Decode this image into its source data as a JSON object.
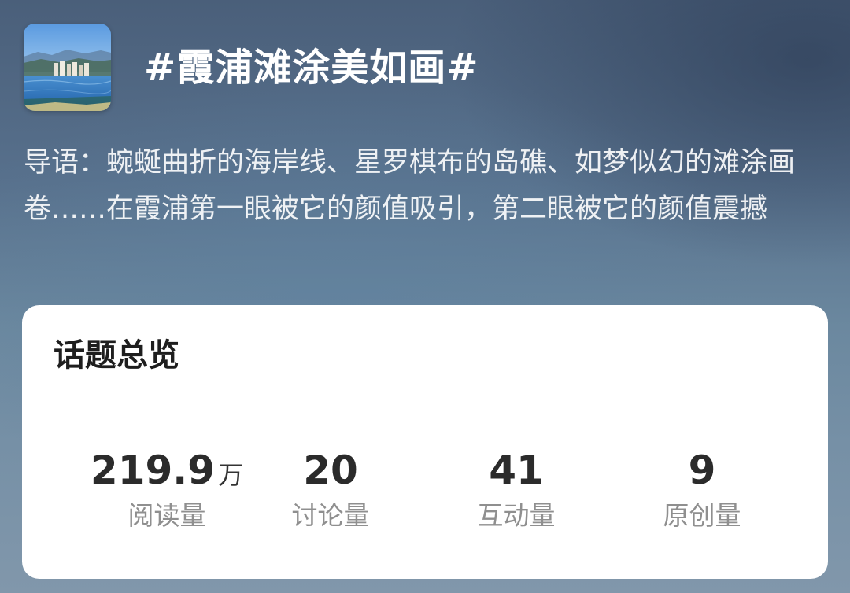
{
  "topic": {
    "title": "#霞浦滩涂美如画#",
    "intro": "导语：蜿蜒曲折的海岸线、星罗棋布的岛礁、如梦似幻的滩涂画卷……在霞浦第一眼被它的颜值吸引，第二眼被它的颜值震撼"
  },
  "overview": {
    "title": "话题总览",
    "stats": [
      {
        "value": "219.9",
        "unit": "万",
        "label": "阅读量"
      },
      {
        "value": "20",
        "unit": "",
        "label": "讨论量"
      },
      {
        "value": "41",
        "unit": "",
        "label": "互动量"
      },
      {
        "value": "9",
        "unit": "",
        "label": "原创量"
      }
    ]
  }
}
